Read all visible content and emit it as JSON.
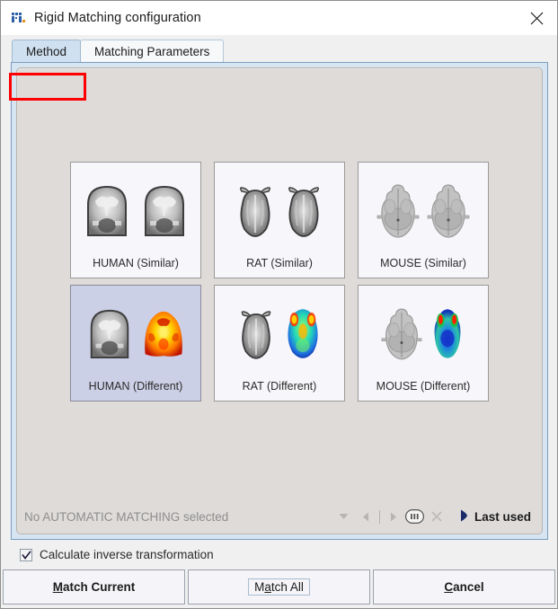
{
  "window": {
    "title": "Rigid Matching configuration",
    "icon": "rigid-matching-icon",
    "close_icon": "close-icon"
  },
  "tabs": [
    {
      "label": "Method",
      "active": true,
      "highlighted": true
    },
    {
      "label": "Matching Parameters",
      "active": false,
      "highlighted": false
    }
  ],
  "methods": {
    "rows": [
      [
        {
          "label": "HUMAN (Similar)",
          "selected": false,
          "kind": "human-similar"
        },
        {
          "label": "RAT (Similar)",
          "selected": false,
          "kind": "rat-similar"
        },
        {
          "label": "MOUSE (Similar)",
          "selected": false,
          "kind": "mouse-similar"
        }
      ],
      [
        {
          "label": "HUMAN (Different)",
          "selected": true,
          "kind": "human-different"
        },
        {
          "label": "RAT (Different)",
          "selected": false,
          "kind": "rat-different"
        },
        {
          "label": "MOUSE (Different)",
          "selected": false,
          "kind": "mouse-different"
        }
      ]
    ]
  },
  "status": {
    "text": "No AUTOMATIC MATCHING selected",
    "controls": [
      {
        "name": "dropdown-arrow-icon"
      },
      {
        "name": "previous-arrow-icon"
      },
      {
        "name": "separator"
      },
      {
        "name": "next-arrow-icon"
      },
      {
        "name": "pause-icon"
      },
      {
        "name": "clear-icon"
      }
    ],
    "last_used": {
      "icon": "play-icon",
      "label": "Last used"
    }
  },
  "options": {
    "inverse_transformation": {
      "label": "Calculate inverse transformation",
      "checked": true
    }
  },
  "buttons": [
    {
      "label": "Match Current",
      "mnemonic": "M",
      "bold": true,
      "focused": false
    },
    {
      "label": "Match All",
      "mnemonic": "a",
      "bold": false,
      "focused": true
    },
    {
      "label": "Cancel",
      "mnemonic": "C",
      "bold": true,
      "focused": false
    }
  ],
  "colors": {
    "accent": "#cfe0f0",
    "highlight": "#ff0000",
    "selected_card": "#ccd0e6",
    "panel": "#dedbd9"
  }
}
